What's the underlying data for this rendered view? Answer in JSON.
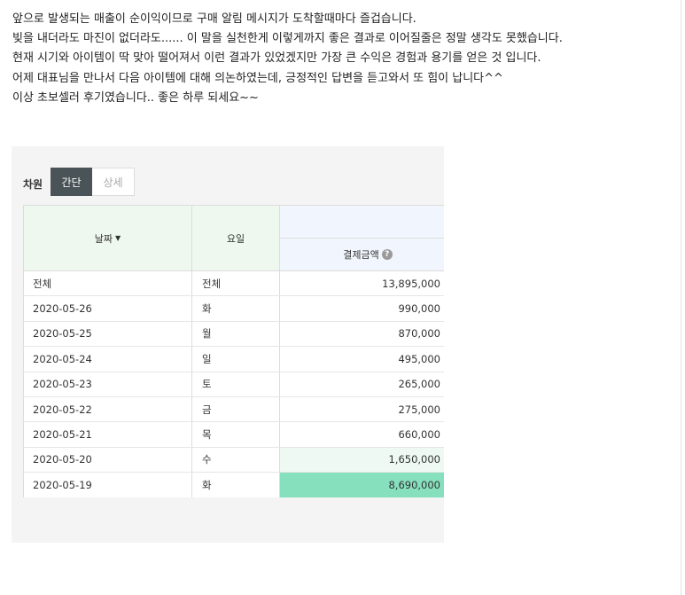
{
  "post": {
    "lines": [
      "앞으로 발생되는 매출이 순이익이므로 구매 알림 메시지가 도착할때마다 즐겁습니다.",
      "빚을 내더라도 마진이 없더라도...... 이 말을 실천한게 이렇게까지 좋은 결과로 이어질줄은 정말 생각도 못했습니다.",
      "현재 시기와 아이템이 딱 맞아 떨어져서 이런 결과가 있었겠지만 가장 큰 수익은 경험과 용기를 얻은 것 입니다.",
      "어제 대표님을 만나서 다음 아이템에 대해 의논하였는데, 긍정적인 답변을 듣고와서 또 힘이 납니다^^",
      "이상 초보셀러 후기였습니다.. 좋은 하루 되세요~~"
    ]
  },
  "report": {
    "dimension_label": "차원",
    "view_simple": "간단",
    "view_detail": "상세",
    "columns": {
      "date": "날짜",
      "date_sort_icon": "caret-down-icon",
      "day": "요일",
      "amount": "결제금액",
      "help_icon": "?"
    },
    "rows": [
      {
        "date": "전체",
        "day": "전체",
        "amount": "13,895,000",
        "highlight": ""
      },
      {
        "date": "2020-05-26",
        "day": "화",
        "amount": "990,000",
        "highlight": ""
      },
      {
        "date": "2020-05-25",
        "day": "월",
        "amount": "870,000",
        "highlight": ""
      },
      {
        "date": "2020-05-24",
        "day": "일",
        "amount": "495,000",
        "highlight": ""
      },
      {
        "date": "2020-05-23",
        "day": "토",
        "amount": "265,000",
        "highlight": ""
      },
      {
        "date": "2020-05-22",
        "day": "금",
        "amount": "275,000",
        "highlight": ""
      },
      {
        "date": "2020-05-21",
        "day": "목",
        "amount": "660,000",
        "highlight": ""
      },
      {
        "date": "2020-05-20",
        "day": "수",
        "amount": "1,650,000",
        "highlight": "#eef9f3"
      },
      {
        "date": "2020-05-19",
        "day": "화",
        "amount": "8,690,000",
        "highlight": "#86e0bd"
      }
    ]
  }
}
